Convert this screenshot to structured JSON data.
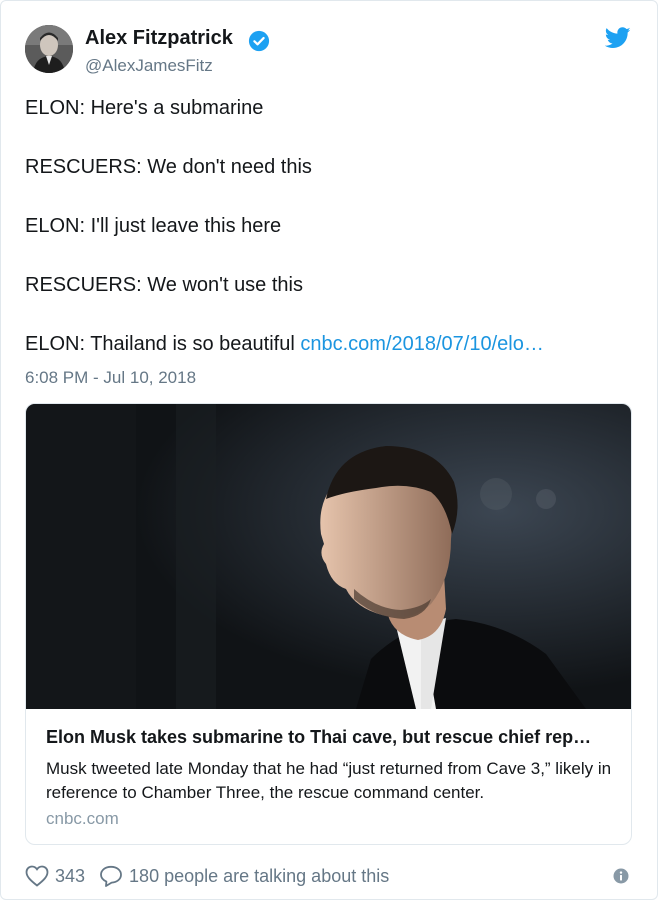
{
  "author": {
    "name": "Alex Fitzpatrick",
    "handle": "@AlexJamesFitz"
  },
  "tweet": {
    "lines": [
      "ELON: Here's a submarine",
      "RESCUERS: We don't need this",
      "ELON: I'll just leave this here",
      "RESCUERS: We won't use this",
      "ELON: Thailand is so beautiful"
    ],
    "link_text": "cnbc.com/2018/07/10/elo…",
    "timestamp": "6:08 PM - Jul 10, 2018"
  },
  "card": {
    "title": "Elon Musk takes submarine to Thai cave, but rescue chief rep…",
    "description": "Musk tweeted late Monday that he had “just returned from Cave 3,” likely in reference to Chamber Three, the rescue command center.",
    "domain": "cnbc.com"
  },
  "footer": {
    "likes": "343",
    "talking": "180 people are talking about this"
  },
  "icons": {
    "verified": "verified-badge-icon",
    "brand": "twitter-bird-icon",
    "like": "heart-icon",
    "reply": "speech-bubble-icon",
    "info": "info-icon"
  },
  "colors": {
    "brand": "#1da1f2",
    "link": "#1b95e0",
    "muted": "#657786",
    "card_domain": "#8899a6"
  }
}
